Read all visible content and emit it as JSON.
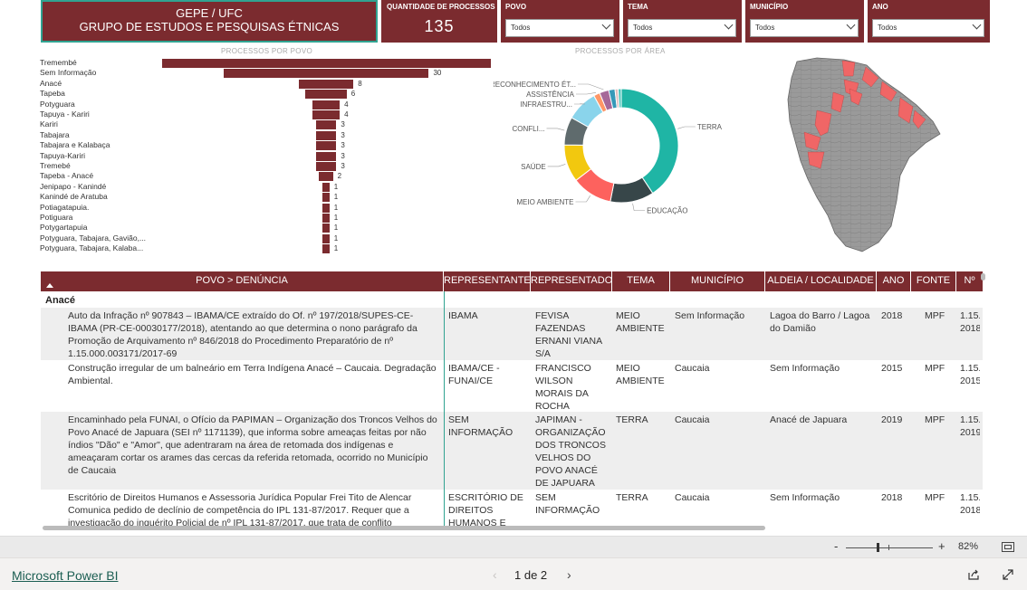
{
  "header": {
    "title_line1": "GEPE / UFC",
    "title_line2": "GRUPO DE ESTUDOS E PESQUISAS ÉTNICAS"
  },
  "kpi": {
    "label": "QUANTIDADE DE PROCESSOS",
    "value": "135"
  },
  "slicers": [
    {
      "label": "POVO",
      "value": "Todos"
    },
    {
      "label": "TEMA",
      "value": "Todos"
    },
    {
      "label": "MUNICÍPIO",
      "value": "Todos"
    },
    {
      "label": "ANO",
      "value": "Todos"
    }
  ],
  "visual_titles": {
    "bar": "PROCESSOS POR POVO",
    "donut": "PROCESSOS POR ÁREA"
  },
  "colors": {
    "brand": "#7b2b2f",
    "accent": "#31a391",
    "map_highlight": "#f06666",
    "map_base": "#999999"
  },
  "chart_data": [
    {
      "type": "bar",
      "orientation": "horizontal",
      "categories": [
        "Tremembé",
        "Sem Informação",
        "Anacé",
        "Tapeba",
        "Potyguara",
        "Tapuya - Kariri",
        "Kariri",
        "Tabajara",
        "Tabajara e Kalabaça",
        "Tapuya-Kariri",
        "Tremebé",
        "Tapeba - Anacé",
        "Jenipapo - Kanindé",
        "Kanindé de Aratuba",
        "Potiagatapuia.",
        "Potiguara",
        "Potygartapuia",
        "Potyguara, Tabajara, Gavião,...",
        "Potyguara, Tabajara, Kalaba..."
      ],
      "values": [
        48,
        30,
        8,
        6,
        4,
        4,
        3,
        3,
        3,
        3,
        3,
        2,
        1,
        1,
        1,
        1,
        1,
        1,
        1
      ],
      "value_labels": [
        "",
        "30",
        "8",
        "6",
        "4",
        "4",
        "3",
        "3",
        "3",
        "3",
        "3",
        "2",
        "1",
        "1",
        "1",
        "1",
        "1",
        "1",
        "1"
      ],
      "xlim": [
        0,
        48
      ]
    },
    {
      "type": "pie",
      "donut": true,
      "labels": [
        "TERRA",
        "EDUCAÇÃO",
        "MEIO AMBIENTE",
        "SAÚDE",
        "CONFLI...",
        "INFRAESTRU...",
        "ASSISTÊNCIA",
        "RECONHECIMENTO ÉT...",
        "",
        "",
        ""
      ],
      "values": [
        46,
        14,
        13,
        12,
        9,
        10,
        2,
        3,
        2,
        1,
        1
      ],
      "colors": [
        "#1fb5a5",
        "#374649",
        "#fd625e",
        "#f2c80f",
        "#5f6b6d",
        "#8ad4eb",
        "#fe9666",
        "#a66999",
        "#3599b8",
        "#dfbfbf",
        "#4ac5bb"
      ]
    }
  ],
  "table": {
    "columns": [
      "POVO > DENÚNCIA",
      "REPRESENTANTE",
      "REPRESENTADO",
      "TEMA",
      "MUNICÍPIO",
      "ALDEIA / LOCALIDADE",
      "ANO",
      "FONTE",
      "Nº"
    ],
    "group": "Anacé",
    "rows": [
      {
        "denuncia": "Auto da Infração nº 907843 – IBAMA/CE extraído do Of. nº 197/2018/SUPES-CE-IBAMA (PR-CE-00030177/2018), atentando ao que determina o nono parágrafo da Promoção de Arquivamento nº 846/2018 do Procedimento Preparatório de nº 1.15.000.003171/2017-69",
        "representante": "IBAMA",
        "representado": "FEVISA FAZENDAS ERNANI VIANA S/A",
        "tema": "MEIO AMBIENTE",
        "municipio": "Sem Informação",
        "aldeia": "Lagoa do Barro / Lagoa do Damião",
        "ano": "2018",
        "fonte": "MPF",
        "numero": "1.15. 2018"
      },
      {
        "denuncia": "Construção irregular de um balneário em Terra Indígena Anacé – Caucaia. Degradação Ambiental.",
        "representante": "IBAMA/CE - FUNAI/CE",
        "representado": "FRANCISCO WILSON MORAIS DA ROCHA",
        "tema": "MEIO AMBIENTE",
        "municipio": "Caucaia",
        "aldeia": "Sem Informação",
        "ano": "2015",
        "fonte": "MPF",
        "numero": "1.15. 2015"
      },
      {
        "denuncia": "Encaminhado pela FUNAI, o Ofício da PAPIMAN – Organização dos Troncos Velhos do Povo Anacé de Japuara (SEI nº 1171139), que informa sobre ameaças feitas por não índios \"Dão\" e \"Amor\", que adentraram na área de retomada dos indígenas e ameaçaram cortar os arames das cercas da referida retomada, ocorrido no Município de Caucaia",
        "representante": "SEM INFORMAÇÃO",
        "representado": "JAPIMAN - ORGANIZAÇÃO DOS TRONCOS VELHOS DO POVO ANACÉ DE JAPUARA",
        "tema": "TERRA",
        "municipio": "Caucaia",
        "aldeia": "Anacé de Japuara",
        "ano": "2019",
        "fonte": "MPF",
        "numero": "1.15. 2019"
      },
      {
        "denuncia": "Escritório de Direitos Humanos e Assessoria Jurídica Popular Frei Tito de Alencar Comunica pedido de declínio de competência do IPL 131-87/2017. Requer que a investigação do inquérito Policial de nº IPL 131-87/2017, que trata de conflito",
        "representante": "ESCRITÓRIO DE DIREITOS HUMANOS E",
        "representado": "SEM INFORMAÇÃO",
        "tema": "TERRA",
        "municipio": "Caucaia",
        "aldeia": "Sem Informação",
        "ano": "2018",
        "fonte": "MPF",
        "numero": "1.15. 2018"
      }
    ]
  },
  "zoom": {
    "minus": "-",
    "plus": "+",
    "level": "82%"
  },
  "footer": {
    "brand": "Microsoft Power BI",
    "page": "1 de 2",
    "prev": "‹",
    "next": "›"
  }
}
